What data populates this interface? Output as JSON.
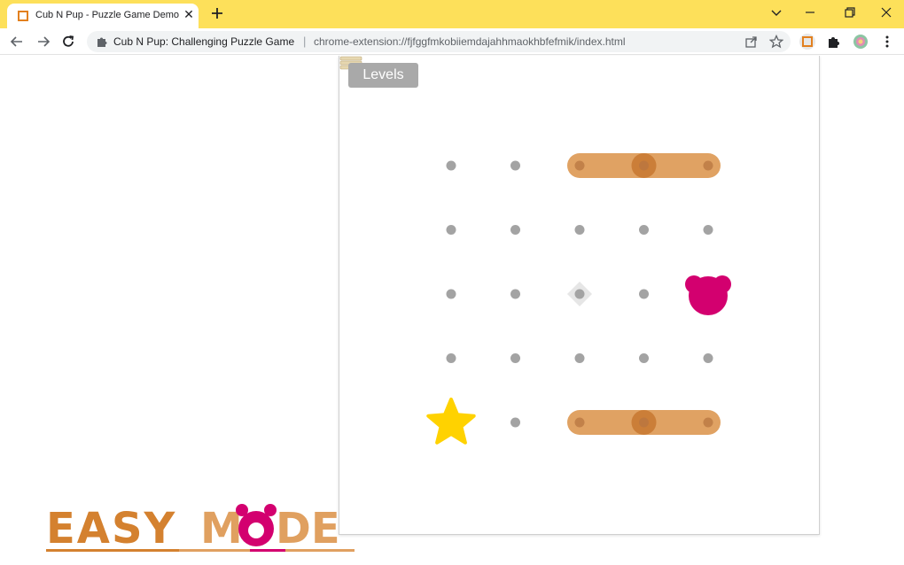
{
  "browser": {
    "tab": {
      "title": "Cub N Pup - Puzzle Game Demo",
      "close_glyph": "✕"
    },
    "omnibox": {
      "site_label": "Cub N Pup: Challenging Puzzle Game",
      "separator": "|",
      "url": "chrome-extension://fjfggfmkobiiemdajahhmaokhbfefmik/index.html"
    }
  },
  "colors": {
    "tabstrip": "#fde05a",
    "bar": "#dd9a56",
    "bar_knob": "#c97a33",
    "dot": "#a3a3a3",
    "bear": "#d3006f",
    "star": "#ffd200",
    "easy_text": "#d4812f",
    "mode_text": "#e0a060"
  },
  "game": {
    "levels_label": "Levels",
    "board": {
      "cols": 5,
      "rows": 5
    },
    "bars": [
      {
        "row": 0,
        "from_col": 2,
        "to_col": 4,
        "knob_col": 3
      },
      {
        "row": 4,
        "from_col": 2,
        "to_col": 4,
        "knob_col": 3
      }
    ],
    "bear": {
      "row": 2,
      "col": 4
    },
    "star": {
      "row": 4,
      "col": 0
    },
    "target": {
      "row": 2,
      "col": 2
    }
  },
  "overlay": {
    "word1": "EASY",
    "word2_left": "M",
    "word2_right": "DE"
  }
}
